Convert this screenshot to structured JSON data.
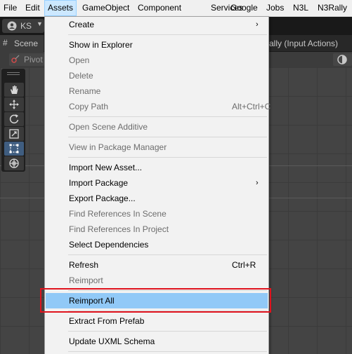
{
  "menubar": {
    "items": [
      "File",
      "Edit",
      "Assets",
      "GameObject",
      "Component",
      "Services",
      "Google",
      "Jobs",
      "N3L",
      "N3Rally"
    ],
    "active_index": 2
  },
  "toolbar": {
    "account_label": "KS"
  },
  "scene_tab": {
    "label": "Scene"
  },
  "other_tab": {
    "label": "ally (Input Actions)"
  },
  "scene_toolbar": {
    "pivot_label": "Pivot"
  },
  "tools": [
    {
      "name": "hand-tool",
      "selected": false
    },
    {
      "name": "move-tool",
      "selected": false
    },
    {
      "name": "rotate-tool",
      "selected": false
    },
    {
      "name": "scale-tool",
      "selected": false
    },
    {
      "name": "rect-tool",
      "selected": true
    },
    {
      "name": "transform-tool",
      "selected": false
    }
  ],
  "assets_menu": {
    "items": [
      {
        "label": "Create",
        "shortcut": "",
        "submenu": true,
        "disabled": false,
        "highlighted": false
      },
      {
        "label": "Show in Explorer",
        "shortcut": "",
        "submenu": false,
        "disabled": false,
        "highlighted": false
      },
      {
        "label": "Open",
        "shortcut": "",
        "submenu": false,
        "disabled": true,
        "highlighted": false
      },
      {
        "label": "Delete",
        "shortcut": "",
        "submenu": false,
        "disabled": true,
        "highlighted": false
      },
      {
        "label": "Rename",
        "shortcut": "",
        "submenu": false,
        "disabled": true,
        "highlighted": false
      },
      {
        "label": "Copy Path",
        "shortcut": "Alt+Ctrl+C",
        "submenu": false,
        "disabled": true,
        "highlighted": false
      },
      {
        "label": "Open Scene Additive",
        "shortcut": "",
        "submenu": false,
        "disabled": true,
        "highlighted": false
      },
      {
        "label": "View in Package Manager",
        "shortcut": "",
        "submenu": false,
        "disabled": true,
        "highlighted": false
      },
      {
        "label": "Import New Asset...",
        "shortcut": "",
        "submenu": false,
        "disabled": false,
        "highlighted": false
      },
      {
        "label": "Import Package",
        "shortcut": "",
        "submenu": true,
        "disabled": false,
        "highlighted": false
      },
      {
        "label": "Export Package...",
        "shortcut": "",
        "submenu": false,
        "disabled": false,
        "highlighted": false
      },
      {
        "label": "Find References In Scene",
        "shortcut": "",
        "submenu": false,
        "disabled": true,
        "highlighted": false
      },
      {
        "label": "Find References In Project",
        "shortcut": "",
        "submenu": false,
        "disabled": true,
        "highlighted": false
      },
      {
        "label": "Select Dependencies",
        "shortcut": "",
        "submenu": false,
        "disabled": false,
        "highlighted": false
      },
      {
        "label": "Refresh",
        "shortcut": "Ctrl+R",
        "submenu": false,
        "disabled": false,
        "highlighted": false
      },
      {
        "label": "Reimport",
        "shortcut": "",
        "submenu": false,
        "disabled": true,
        "highlighted": false
      },
      {
        "label": "Reimport All",
        "shortcut": "",
        "submenu": false,
        "disabled": false,
        "highlighted": true
      },
      {
        "label": "Extract From Prefab",
        "shortcut": "",
        "submenu": false,
        "disabled": false,
        "highlighted": false
      },
      {
        "label": "Update UXML Schema",
        "shortcut": "",
        "submenu": false,
        "disabled": false,
        "highlighted": false
      }
    ],
    "submenu_glyph": "›"
  },
  "icons": {
    "scene_tab": "grid-icon",
    "account": "account-icon",
    "caret": "caret-down-icon",
    "pivot": "pivot-icon",
    "gizmo": "gizmo-icon"
  },
  "colors": {
    "menu_highlight": "#91c9f7",
    "annotation_box": "#e0141e",
    "selected_tool": "#3f5d80"
  }
}
